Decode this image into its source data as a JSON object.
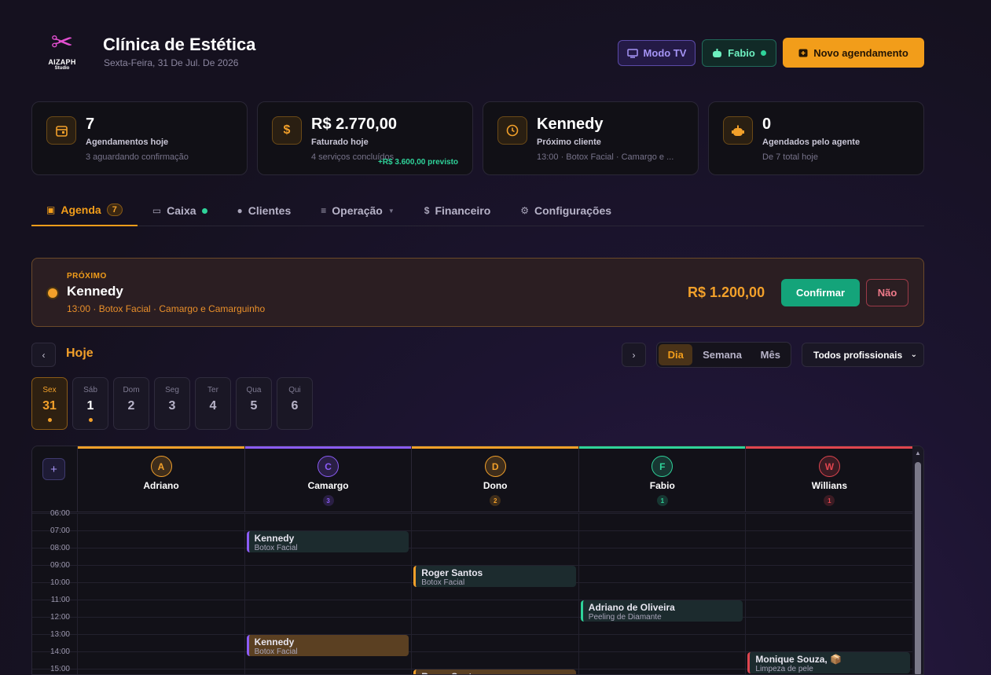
{
  "app": {
    "logo_line1": "AIZAPH",
    "logo_line2": "Studio",
    "title": "Clínica de Estética",
    "date": "Sexta-Feira, 31 De Jul. De 2026"
  },
  "header": {
    "tv_label": "Modo TV",
    "user_label": "Fabio",
    "new_label": "Novo agendamento"
  },
  "stats": [
    {
      "icon": "calendar-icon",
      "value": "7",
      "label": "Agendamentos hoje",
      "sub": "3 aguardando confirmação"
    },
    {
      "icon": "dollar-icon",
      "value": "R$ 2.770,00",
      "label": "Faturado hoje",
      "sub": "4 serviços concluídos",
      "extra": "+R$ 3.600,00 previsto"
    },
    {
      "icon": "clock-icon",
      "value": "Kennedy",
      "label": "Próximo cliente",
      "sub": "13:00 · Botox Facial · Camargo e ..."
    },
    {
      "icon": "robot-icon",
      "value": "0",
      "label": "Agendados pelo agente",
      "sub": "De 7 total hoje"
    }
  ],
  "tabs": [
    {
      "label": "Agenda",
      "badge": "7",
      "active": true
    },
    {
      "label": "Caixa"
    },
    {
      "label": "Clientes"
    },
    {
      "label": "Operação"
    },
    {
      "label": "Financeiro"
    },
    {
      "label": "Configurações"
    }
  ],
  "next": {
    "kicker": "PRÓXIMO",
    "name": "Kennedy",
    "detail": "13:00 · Botox Facial · Camargo e Camarguinho",
    "price": "R$ 1.200,00",
    "confirm_label": "Confirmar",
    "no_label": "Não"
  },
  "nav": {
    "prev": "‹",
    "today": "Hoje",
    "next": "›",
    "views": [
      "Dia",
      "Semana",
      "Mês"
    ],
    "active_view": "Dia",
    "filter": "Todos profissionais"
  },
  "days": [
    {
      "name": "Sex",
      "num": "31",
      "marked": true,
      "active": true
    },
    {
      "name": "Sáb",
      "num": "1",
      "marked": true
    },
    {
      "name": "Dom",
      "num": "2"
    },
    {
      "name": "Seg",
      "num": "3"
    },
    {
      "name": "Ter",
      "num": "4"
    },
    {
      "name": "Qua",
      "num": "5"
    },
    {
      "name": "Qui",
      "num": "6"
    }
  ],
  "calendar": {
    "add_label": "+",
    "professionals": [
      {
        "initial": "A",
        "name": "Adriano",
        "count": "",
        "color": "#f2a02a"
      },
      {
        "initial": "C",
        "name": "Camargo",
        "count": "3",
        "color": "#8b5cf6"
      },
      {
        "initial": "D",
        "name": "Dono",
        "count": "2",
        "color": "#f2a02a"
      },
      {
        "initial": "F",
        "name": "Fabio",
        "count": "1",
        "color": "#2fd39a"
      },
      {
        "initial": "W",
        "name": "Willians",
        "count": "1",
        "color": "#e0454f"
      }
    ],
    "hours": [
      "06:00",
      "07:00",
      "08:00",
      "09:00",
      "10:00",
      "11:00",
      "12:00",
      "13:00",
      "14:00",
      "15:00"
    ],
    "appointments": [
      {
        "name": "Kennedy",
        "service": "Botox Facial",
        "col": 1,
        "start": 7,
        "color": "#8b5cf6",
        "style": "teal"
      },
      {
        "name": "Roger Santos",
        "service": "Botox Facial",
        "col": 2,
        "start": 9,
        "color": "#f2a02a",
        "style": "teal"
      },
      {
        "name": "Adriano de Oliveira",
        "service": "Peeling de Diamante",
        "col": 3,
        "start": 11,
        "color": "#2fd39a",
        "style": "teal"
      },
      {
        "name": "Kennedy",
        "service": "Botox Facial",
        "col": 1,
        "start": 13,
        "color": "#8b5cf6",
        "style": "amber"
      },
      {
        "name": "Monique Souza, 📦",
        "service": "Limpeza de pele",
        "col": 4,
        "start": 14,
        "color": "#e0454f",
        "style": "teal"
      },
      {
        "name": "Roger Santos",
        "service": "",
        "col": 2,
        "start": 15,
        "color": "#f2a02a",
        "style": "amber"
      }
    ]
  }
}
